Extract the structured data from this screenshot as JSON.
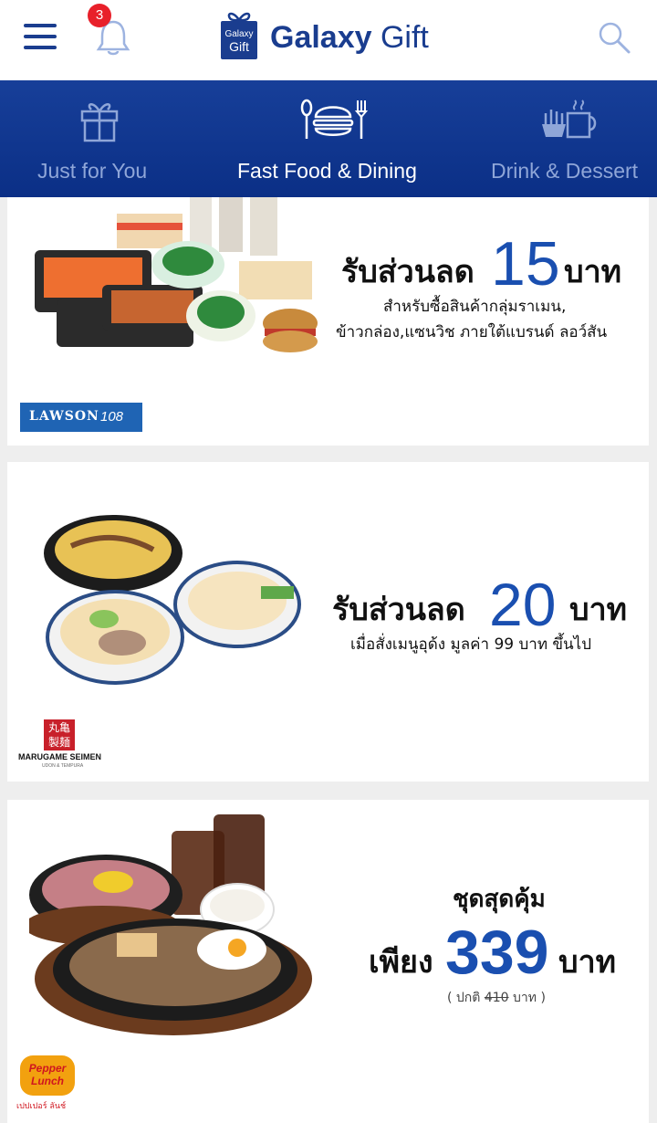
{
  "header": {
    "brand_primary": "Galaxy",
    "brand_secondary": "Gift",
    "logo_box_line1": "Galaxy",
    "logo_box_line2": "Gift",
    "notification_count": "3",
    "menu_icon": "hamburger-icon",
    "bell_icon": "bell-icon",
    "search_icon": "search-icon"
  },
  "categories": [
    {
      "label": "Just for You",
      "icon": "gift-icon",
      "active": false
    },
    {
      "label": "Fast Food & Dining",
      "icon": "dining-icon",
      "active": true
    },
    {
      "label": "Drink & Dessert",
      "icon": "drink-icon",
      "active": false
    }
  ],
  "offers": [
    {
      "headline_prefix": "รับส่วนลด",
      "amount": "15",
      "unit": "บาท",
      "desc_line1": "สำหรับซื้อสินค้ากลุ่มราเมน,",
      "desc_line2": "ข้าวกล่อง,แซนวิช ภายใต้แบรนด์ ลอว์สัน",
      "brand_logo_text": "LAWSON",
      "brand_logo_suffix": "108"
    },
    {
      "headline_prefix": "รับส่วนลด",
      "amount": "20",
      "unit": "บาท",
      "desc_line1": "เมื่อสั่งเมนูอุด้ง มูลค่า 99 บาท ขึ้นไป",
      "brand_logo_text": "MARUGAME SEIMEN",
      "brand_logo_sub": "UDON & TEMPURA",
      "brand_logo_kanji": "丸亀製麺"
    },
    {
      "headline_top": "ชุดสุดคุ้ม",
      "headline_prefix": "เพียง",
      "amount": "339",
      "unit": "บาท",
      "note_prefix": "( ปกติ",
      "note_old_price": "410",
      "note_suffix": "บาท )",
      "brand_logo_text": "Pepper Lunch",
      "brand_logo_thai": "เปปเปอร์ ลันช์"
    }
  ],
  "colors": {
    "brand_blue": "#1a3d8f",
    "accent_blue": "#1a4fb0",
    "badge_red": "#e8202a",
    "nav_dim": "#8fa6d8"
  }
}
